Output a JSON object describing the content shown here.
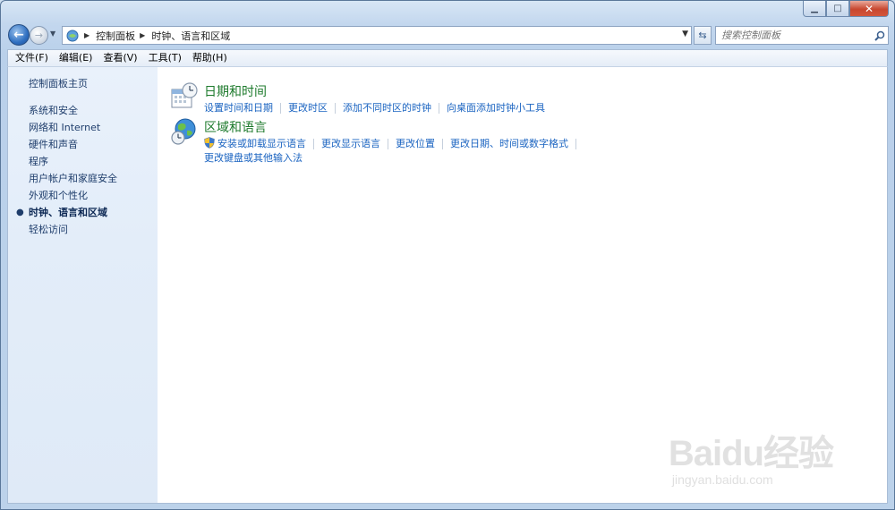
{
  "window": {
    "caption": {
      "minimize": "▁",
      "maximize": "□",
      "close": "✕"
    }
  },
  "address_bar": {
    "breadcrumbs": [
      "控制面板",
      "时钟、语言和区域"
    ]
  },
  "search": {
    "placeholder": "搜索控制面板"
  },
  "menu": [
    "文件(F)",
    "编辑(E)",
    "查看(V)",
    "工具(T)",
    "帮助(H)"
  ],
  "sidebar": {
    "home": "控制面板主页",
    "items": [
      {
        "label": "系统和安全"
      },
      {
        "label": "网络和 Internet"
      },
      {
        "label": "硬件和声音"
      },
      {
        "label": "程序"
      },
      {
        "label": "用户帐户和家庭安全"
      },
      {
        "label": "外观和个性化"
      },
      {
        "label": "时钟、语言和区域",
        "active": true
      },
      {
        "label": "轻松访问"
      }
    ],
    "active_bullet": "●"
  },
  "categories": [
    {
      "title": "日期和时间",
      "icon": "calendar-clock-icon",
      "links": [
        "设置时间和日期",
        "更改时区",
        "添加不同时区的时钟",
        "向桌面添加时钟小工具"
      ]
    },
    {
      "title": "区域和语言",
      "icon": "globe-clock-icon",
      "links": [
        "安装或卸载显示语言",
        "更改显示语言",
        "更改位置",
        "更改日期、时间或数字格式"
      ],
      "links_row2": [
        "更改键盘或其他输入法"
      ]
    }
  ],
  "watermark": {
    "main": "Baidu经验",
    "sub": "jingyan.baidu.com"
  },
  "colors": {
    "link": "#1b64c1",
    "category_title": "#1d7a2c",
    "sidebar_bg": "#e3edf9"
  }
}
